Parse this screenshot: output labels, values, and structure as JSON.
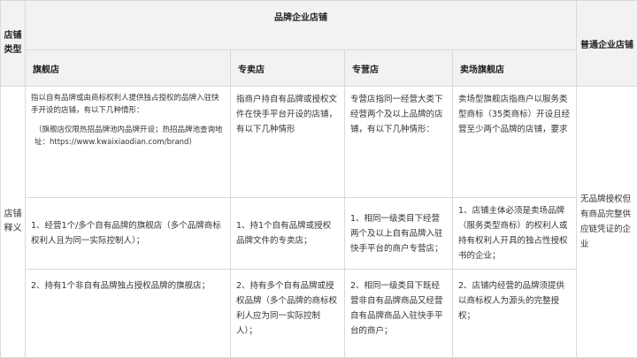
{
  "table": {
    "corner_label_line1": "店铺",
    "corner_label_line2": "类型",
    "group_header": "品牌企业店铺",
    "last_header": "普通企业店铺",
    "columns": [
      "旗舰店",
      "专卖店",
      "专营店",
      "卖场旗舰店"
    ],
    "row_label_line1": "店铺",
    "row_label_line2": "释义",
    "definitions": [
      "指以自有品牌或由商标权利人提供独占授权的品牌入驻快手开设的店铺，有以下几种情形：",
      "指商户持自有品牌或授权文件在快手平台开设的店铺，有以下几种情形",
      "专营店指同一经营大类下经营两个及以上品牌的店铺，有以下几种情形：",
      "卖场型旗舰店指商户以服务类型商标（35类商标）开设且经营至少两个品牌的店铺，要求"
    ],
    "flagship_note": "（旗舰店仅限热招品牌池内品牌开设；热招品牌池查询地址：https://www.kwaixiaodian.com/brand）",
    "ordinary_desc": "无品牌授权但有商品完整供应链凭证的企业",
    "case1": [
      "1、经营1个/多个自有品牌的旗舰店（多个品牌商标权利人且为同一实际控制人）；",
      "1、持1个自有品牌或授权品牌文件的专卖店；",
      "1、相同一级类目下经营两个及以上自有品牌入驻快手平台的商户专营店；",
      "1、店铺主体必须是卖场品牌（服务类型商标）的权利人或持有权利人开具的独占性授权书的企业；"
    ],
    "case2": [
      "2、持有1个非自有品牌独占授权品牌的旗舰店；",
      "2、持有多个自有品牌或授权品牌（多个品牌的商标权利人应为同一实际控制人）；",
      "2、相同一级类目下既经营非自有品牌商品又经营自有品牌商品入驻快手平台的商户；",
      "2、店铺内经营的品牌须提供以商标权人为源头的完整授权；"
    ]
  }
}
